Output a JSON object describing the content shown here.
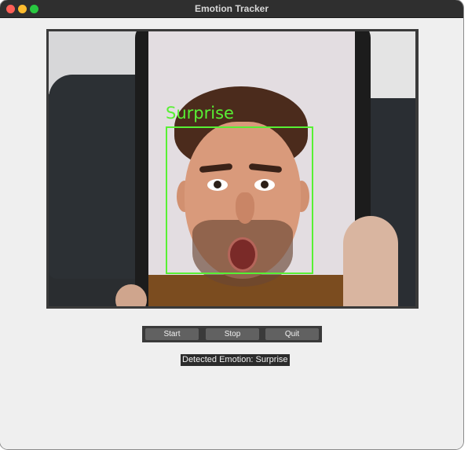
{
  "window": {
    "title": "Emotion Tracker"
  },
  "video": {
    "detection_label": "Surprise",
    "box_color": "#58f034"
  },
  "controls": {
    "start_label": "Start",
    "stop_label": "Stop",
    "quit_label": "Quit"
  },
  "status": {
    "text": "Detected Emotion: Surprise"
  }
}
